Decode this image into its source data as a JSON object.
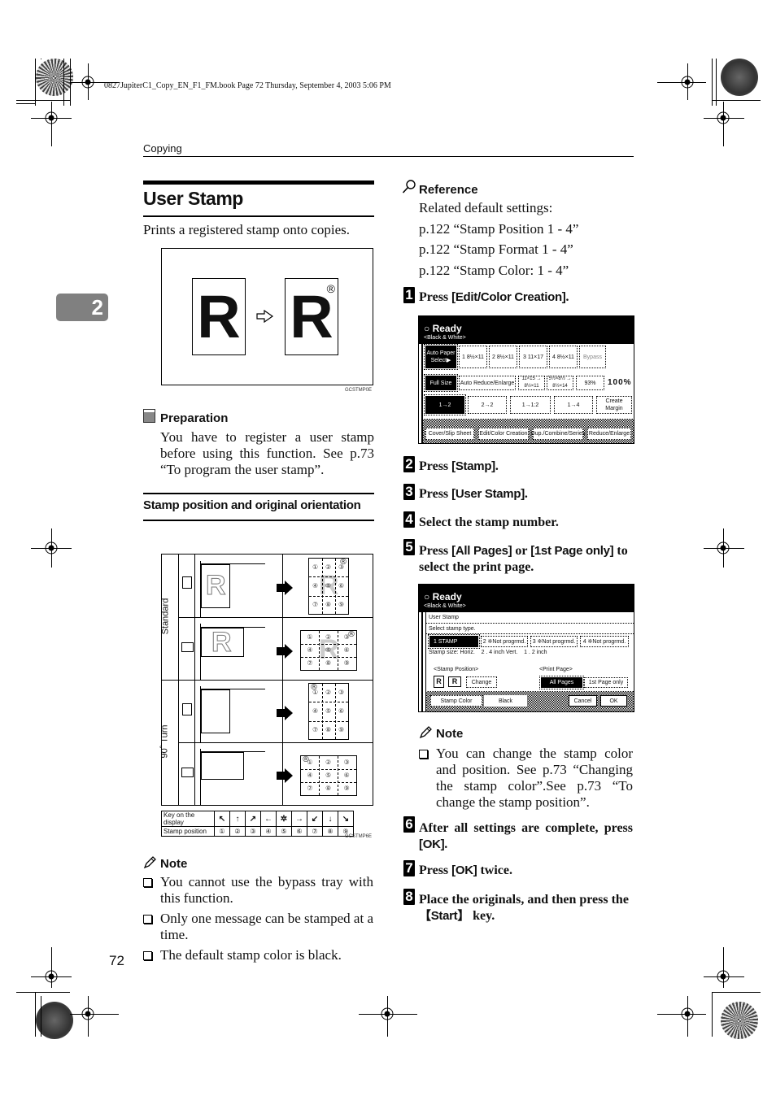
{
  "book_info": "0827JupiterC1_Copy_EN_F1_FM.book  Page 72  Thursday, September 4, 2003  5:06 PM",
  "running_head": "Copying",
  "chapter_tab": "2",
  "page_number": "72",
  "left": {
    "title": "User Stamp",
    "intro": "Prints a registered stamp onto copies.",
    "figure1": {
      "letter": "R",
      "stamp_mark": "®",
      "code": "GCSTMP0E"
    },
    "preparation": {
      "heading": "Preparation",
      "text": "You have to register a user stamp before using this function. See p.73 “To program the user stamp”."
    },
    "subheading": "Stamp position and original orientation",
    "figure2": {
      "row_groups": [
        "Standard",
        "90˚ Turn"
      ],
      "positions": [
        "①",
        "②",
        "③",
        "④",
        "⑤",
        "⑥",
        "⑦",
        "⑧",
        "⑨"
      ],
      "key_table": {
        "row1_label": "Key on the display",
        "keys": [
          "↖",
          "↑",
          "↗",
          "←",
          "✲",
          "→",
          "↙",
          "↓",
          "↘"
        ],
        "row2_label": "Stamp position",
        "positions": [
          "①",
          "②",
          "③",
          "④",
          "⑤",
          "⑥",
          "⑦",
          "⑧",
          "⑨"
        ]
      },
      "code": "GCSTMP6E"
    },
    "note": {
      "heading": "Note",
      "items": [
        "You cannot use the bypass tray with this function.",
        "Only one message can be stamped at a time.",
        "The default stamp color is black."
      ]
    }
  },
  "right": {
    "reference": {
      "heading": "Reference",
      "lines": [
        "Related default settings:",
        "p.122 “Stamp Position 1 - 4”",
        "p.122 “Stamp Format 1 - 4”",
        "p.122 “Stamp Color: 1 - 4”"
      ]
    },
    "steps": [
      {
        "num": "1",
        "pre": "Press ",
        "key": "[Edit/Color Creation]",
        "post": "."
      },
      {
        "num": "2",
        "pre": "Press ",
        "key": "[Stamp]",
        "post": "."
      },
      {
        "num": "3",
        "pre": "Press ",
        "key": "[User Stamp]",
        "post": "."
      },
      {
        "num": "4",
        "pre": "Select the stamp number.",
        "key": "",
        "post": ""
      },
      {
        "num": "5",
        "pre": "Press ",
        "key": "[All Pages]",
        "mid": " or ",
        "key2": "[1st Page only]",
        "post": " to select the print page."
      },
      {
        "num": "6",
        "pre": "After all settings are complete, press ",
        "key": "[OK]",
        "post": "."
      },
      {
        "num": "7",
        "pre": "Press ",
        "key": "[OK]",
        "post": " twice."
      },
      {
        "num": "8",
        "pre": "Place the originals, and then press the ",
        "key": "【Start】",
        "post": " key."
      }
    ],
    "screen1": {
      "status": "Ready",
      "mode": "<Black & White>",
      "paper_buttons": [
        {
          "label": "Auto Paper Select▶",
          "selected": true
        },
        {
          "label": "1  8½×11",
          "selected": false
        },
        {
          "label": "2  8½×11",
          "selected": false
        },
        {
          "label": "3  11×17",
          "selected": false
        },
        {
          "label": "4  8½×11",
          "selected": false
        },
        {
          "label": "Bypass",
          "selected": false
        }
      ],
      "ratio_buttons": [
        {
          "label": "Full Size",
          "selected": true
        },
        {
          "label": "Auto Reduce/Enlarge",
          "selected": false
        },
        {
          "label": "11×15 → 8½×11",
          "selected": false
        },
        {
          "label": "5½×8½ → 8½×14",
          "selected": false
        },
        {
          "label": "93%",
          "selected": false
        }
      ],
      "ratio_value": "100%",
      "duplex_buttons": [
        "1→2",
        "2→2",
        "1→1:2",
        "1→4",
        "Create Margin"
      ],
      "bottom_tabs": [
        "Cover/Slip Sheet",
        "Edit/Color Creation",
        "Dup./Combine/Series",
        "Reduce/Enlarge"
      ]
    },
    "screen2": {
      "status": "Ready",
      "mode": "<Black & White>",
      "title": "User Stamp",
      "instruction": "Select stamp type.",
      "stamp_types": [
        {
          "label": "1  STAMP",
          "selected": true
        },
        {
          "label": "2  ※Not progrmd.",
          "selected": false
        },
        {
          "label": "3  ※Not progrmd.",
          "selected": false
        },
        {
          "label": "4  ※Not progrmd.",
          "selected": false
        }
      ],
      "stamp_size": "Stamp size: Horiz.    2 . 4 inch Vert.    1 . 2 inch",
      "position_label": "<Stamp Position>",
      "change_button": "Change",
      "print_page_label": "<Print Page>",
      "print_page_options": [
        {
          "label": "All Pages",
          "selected": true
        },
        {
          "label": "1st Page only",
          "selected": false
        }
      ],
      "stamp_color_button": "Stamp Color",
      "stamp_color_value": "Black",
      "cancel_button": "Cancel",
      "ok_button": "OK"
    },
    "note": {
      "heading": "Note",
      "items": [
        "You can change the stamp color and position. See p.73 “Changing the stamp color”.See p.73 “To change the stamp position”."
      ]
    }
  }
}
